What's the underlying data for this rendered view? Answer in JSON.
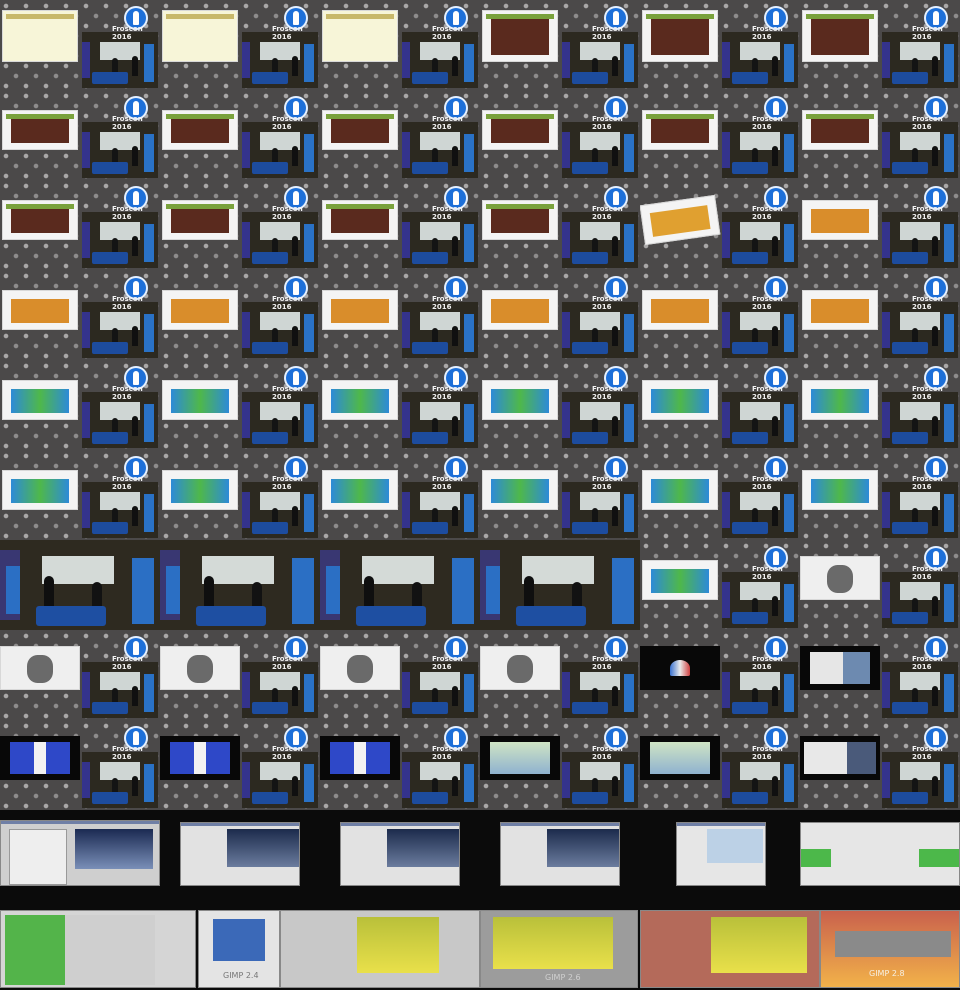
{
  "logo_text": "Froscon 2016",
  "caption_gimp24": "GIMP 2.4",
  "caption_gimp26": "GIMP 2.6",
  "caption_gimp28": "GIMP 2.8",
  "colors": {
    "froscon_blue": "#1d6fd8",
    "stage_blue": "#2b6fc4",
    "background": "#4b4949"
  }
}
